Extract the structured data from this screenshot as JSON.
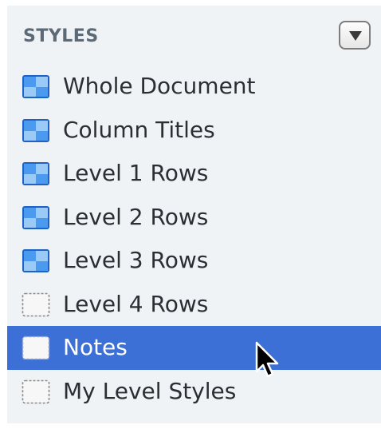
{
  "header": {
    "title": "STYLES"
  },
  "styles": [
    {
      "label": "Whole Document",
      "icon": "filled-style-icon",
      "selected": false
    },
    {
      "label": "Column Titles",
      "icon": "filled-style-icon",
      "selected": false
    },
    {
      "label": "Level 1 Rows",
      "icon": "filled-style-icon",
      "selected": false
    },
    {
      "label": "Level 2 Rows",
      "icon": "filled-style-icon",
      "selected": false
    },
    {
      "label": "Level 3 Rows",
      "icon": "filled-style-icon",
      "selected": false
    },
    {
      "label": "Level 4 Rows",
      "icon": "empty-style-icon",
      "selected": false
    },
    {
      "label": "Notes",
      "icon": "empty-style-icon",
      "selected": true
    },
    {
      "label": "My Level Styles",
      "icon": "empty-style-icon",
      "selected": false
    }
  ],
  "colors": {
    "panel_bg": "#eff3f6",
    "selection": "#3c70d6",
    "icon_blue": "#2f7fe0",
    "header_text": "#5b6a76"
  }
}
